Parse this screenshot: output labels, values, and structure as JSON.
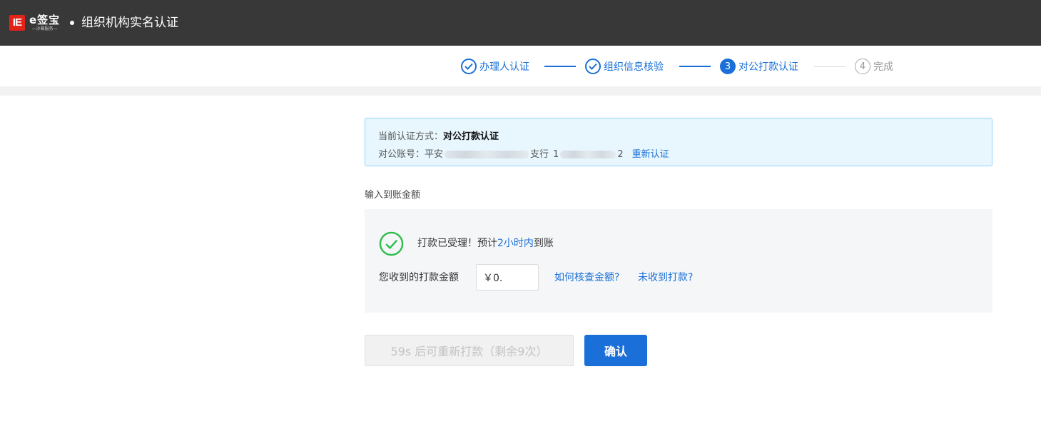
{
  "header": {
    "logo_mark": "IE",
    "logo_name": "e签宝",
    "logo_sub": "—沙箱服务—",
    "title": "组织机构实名认证"
  },
  "steps": [
    {
      "label": "办理人认证",
      "status": "done"
    },
    {
      "label": "组织信息核验",
      "status": "done"
    },
    {
      "label": "对公打款认证",
      "status": "active",
      "number": "3"
    },
    {
      "label": "完成",
      "status": "todo",
      "number": "4"
    }
  ],
  "info": {
    "method_key": "当前认证方式：",
    "method_value": "对公打款认证",
    "account_key": "对公账号：",
    "account_bank_prefix": "平安",
    "account_bank_suffix": "支行",
    "account_no_prefix": "1",
    "account_no_suffix": "2",
    "reauth_link": "重新认证"
  },
  "section_label": "输入到账金额",
  "status": {
    "text_before": "打款已受理！预计",
    "highlight": "2小时内",
    "text_after": "到账"
  },
  "amount": {
    "label": "您收到的打款金额",
    "value": "￥0.",
    "how_to_check_link": "如何核查金额?",
    "not_received_link": "未收到打款?"
  },
  "buttons": {
    "resend_label": "59s 后可重新打款（剩余9次）",
    "confirm_label": "确认"
  },
  "colors": {
    "header_bg": "#383838",
    "accent": "#1a70d8",
    "success": "#2fbd4e",
    "logo_red": "#e2231a",
    "info_bg": "#e8f6fd"
  }
}
